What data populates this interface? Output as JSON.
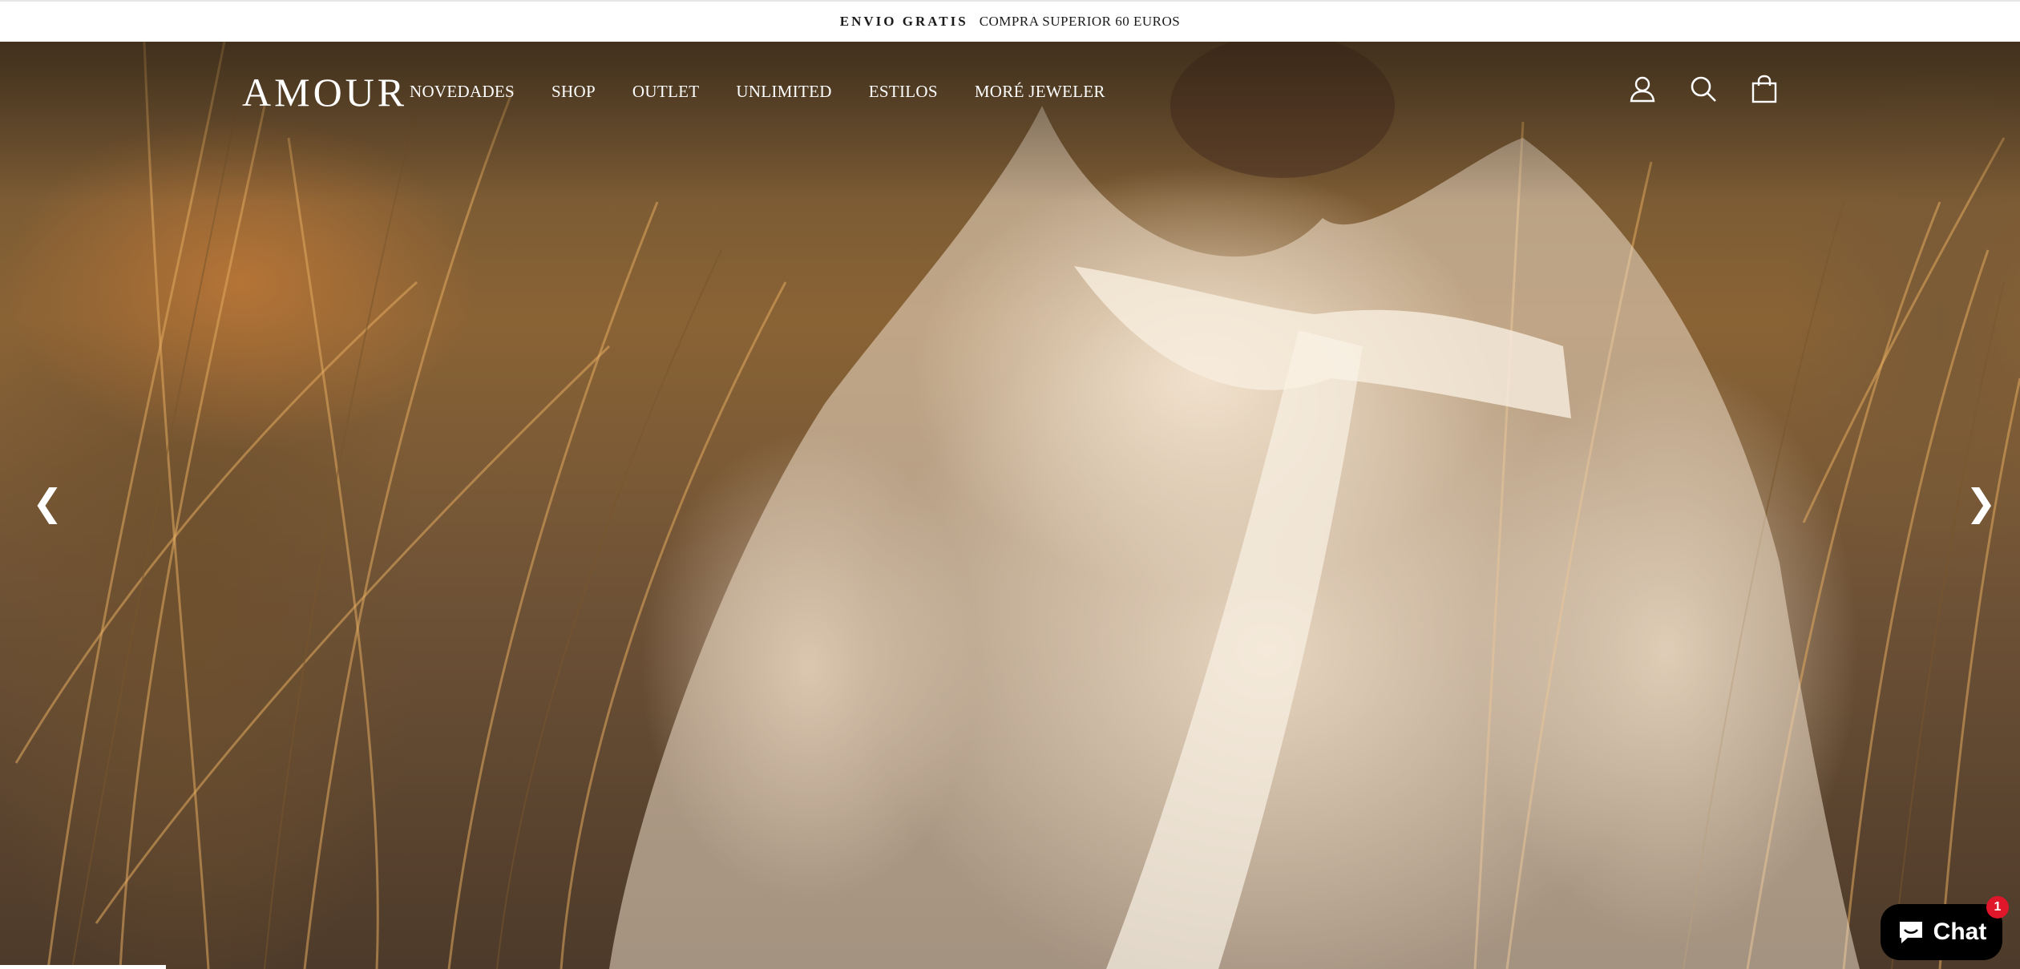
{
  "announcement": {
    "bold": "ENVIO GRATIS",
    "text": "COMPRA SUPERIOR 60 EUROS"
  },
  "header": {
    "logo": "AMOUR",
    "nav": [
      {
        "label": "NOVEDADES"
      },
      {
        "label": "SHOP"
      },
      {
        "label": "OUTLET"
      },
      {
        "label": "UNLIMITED"
      },
      {
        "label": "ESTILOS"
      },
      {
        "label": "MORÉ JEWELER"
      }
    ],
    "icons": [
      "account-icon",
      "search-icon",
      "cart-icon"
    ]
  },
  "hero": {
    "prev_arrow": "❮",
    "next_arrow": "❯"
  },
  "chat": {
    "label": "Chat",
    "badge": "1",
    "color": "#000000",
    "badge_color": "#e0162b"
  }
}
